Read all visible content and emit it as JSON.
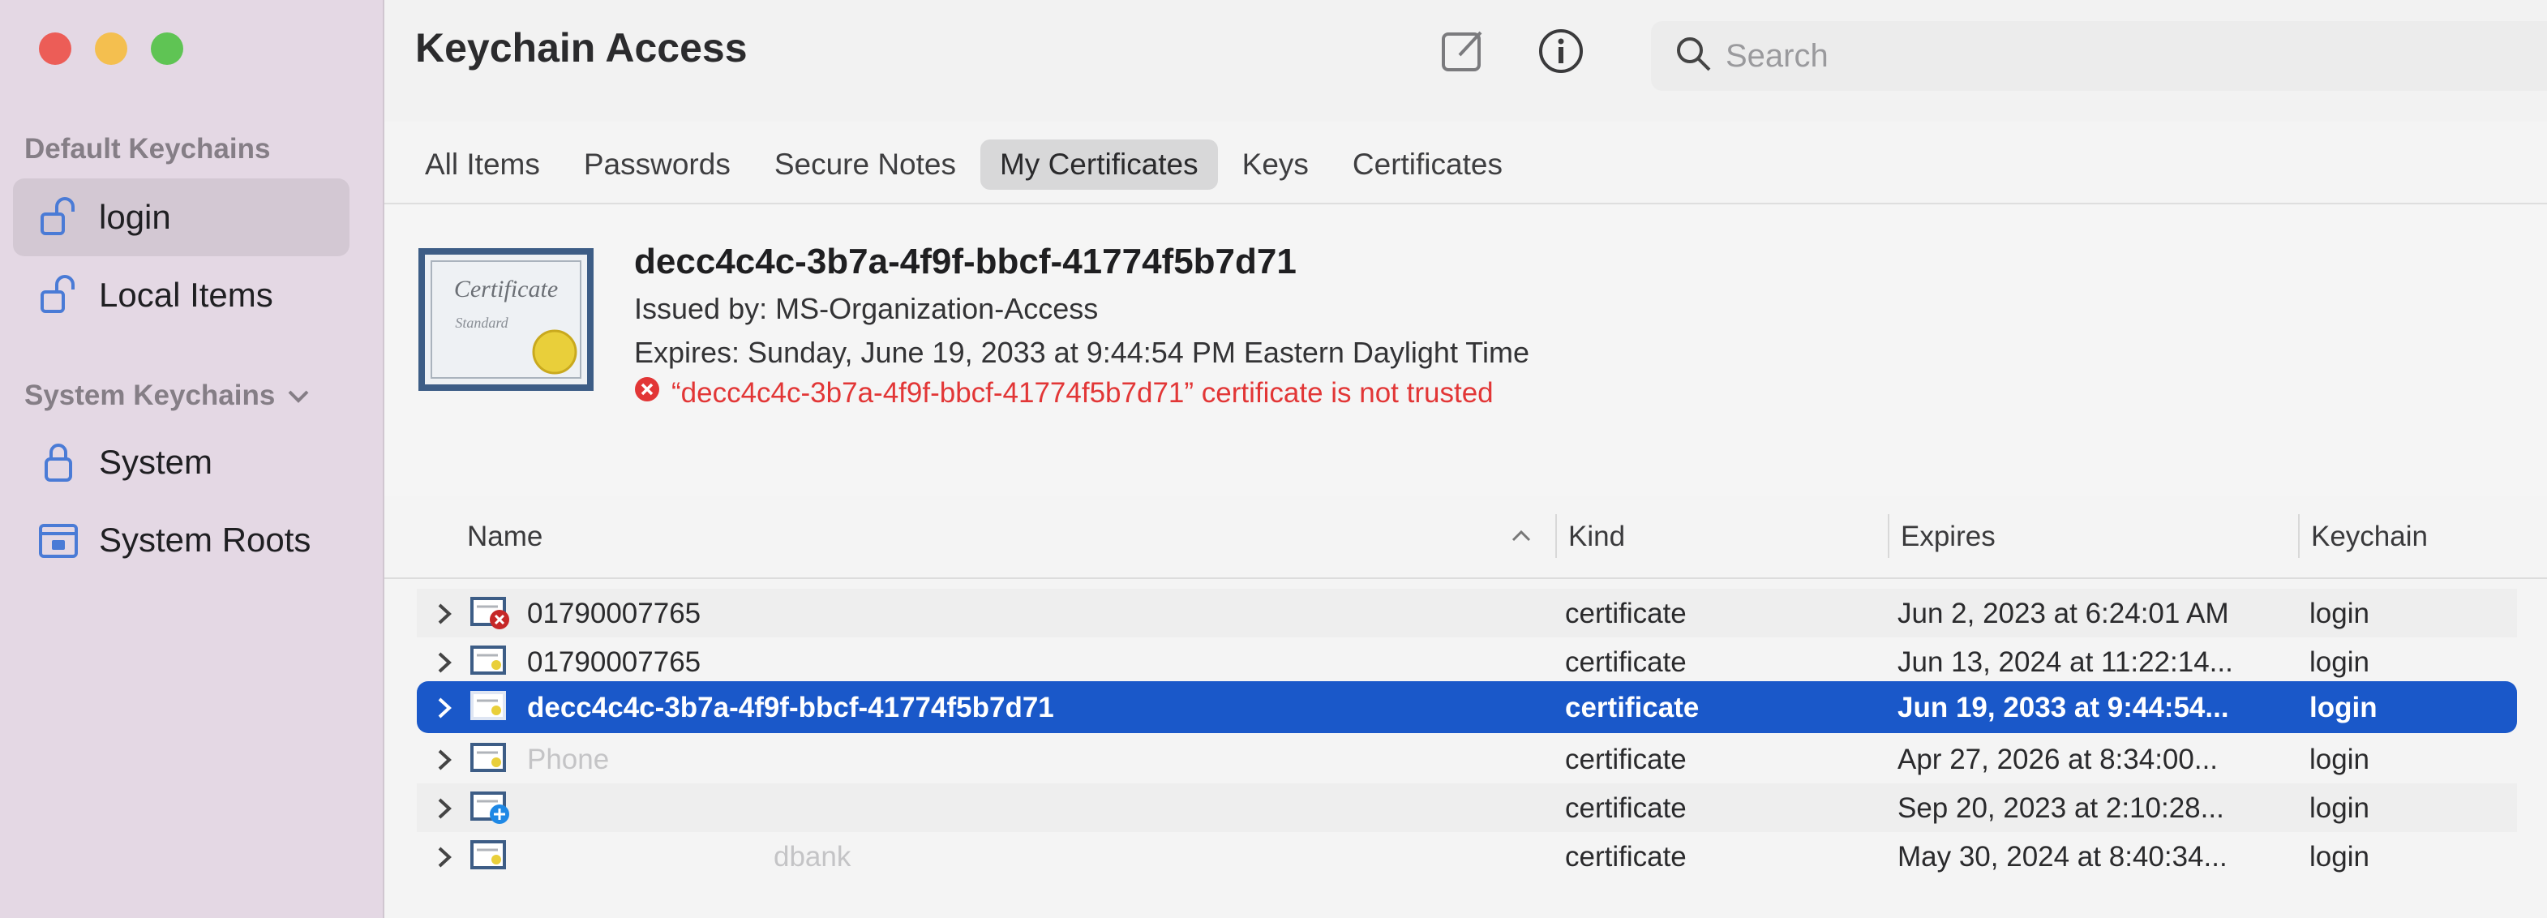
{
  "sidebar": {
    "sections": [
      {
        "label": "Default Keychains"
      },
      {
        "label": "System Keychains"
      }
    ],
    "items": [
      {
        "label": "login",
        "icon": "unlocked-padlock-icon"
      },
      {
        "label": "Local Items",
        "icon": "unlocked-padlock-icon"
      },
      {
        "label": "System",
        "icon": "padlock-icon"
      },
      {
        "label": "System Roots",
        "icon": "cabinet-lock-icon"
      }
    ]
  },
  "toolbar": {
    "title": "Keychain Access",
    "search_placeholder": "Search"
  },
  "tabs": [
    {
      "label": "All Items"
    },
    {
      "label": "Passwords"
    },
    {
      "label": "Secure Notes"
    },
    {
      "label": "My Certificates"
    },
    {
      "label": "Keys"
    },
    {
      "label": "Certificates"
    }
  ],
  "detail": {
    "title": "decc4c4c-3b7a-4f9f-bbcf-41774f5b7d71",
    "issued_by": "Issued by: MS-Organization-Access",
    "expires": "Expires: Sunday, June 19, 2033 at 9:44:54 PM Eastern Daylight Time",
    "trust_error": "“decc4c4c-3b7a-4f9f-bbcf-41774f5b7d71” certificate is not trusted",
    "cert_word": "Certificate",
    "cert_sub": "Standard"
  },
  "table": {
    "columns": {
      "name": "Name",
      "kind": "Kind",
      "expires": "Expires",
      "keychain": "Keychain"
    },
    "rows": [
      {
        "name": "01790007765",
        "kind": "certificate",
        "expires": "Jun 2, 2023 at 6:24:01 AM",
        "keychain": "login",
        "icon": "certificate-error-icon"
      },
      {
        "name": "01790007765",
        "kind": "certificate",
        "expires": "Jun 13, 2024 at 11:22:14...",
        "keychain": "login",
        "icon": "certificate-icon"
      },
      {
        "name": "decc4c4c-3b7a-4f9f-bbcf-41774f5b7d71",
        "kind": "certificate",
        "expires": "Jun 19, 2033 at 9:44:54...",
        "keychain": "login",
        "icon": "certificate-icon"
      },
      {
        "name": "Phone",
        "kind": "certificate",
        "expires": "Apr 27, 2026 at 8:34:00...",
        "keychain": "login",
        "icon": "certificate-icon"
      },
      {
        "name": "",
        "kind": "certificate",
        "expires": "Sep 20, 2023 at 2:10:28...",
        "keychain": "login",
        "icon": "certificate-plus-icon"
      },
      {
        "name": "dbank",
        "kind": "certificate",
        "expires": "May 30, 2024 at 8:40:34...",
        "keychain": "login",
        "icon": "certificate-icon"
      }
    ]
  }
}
